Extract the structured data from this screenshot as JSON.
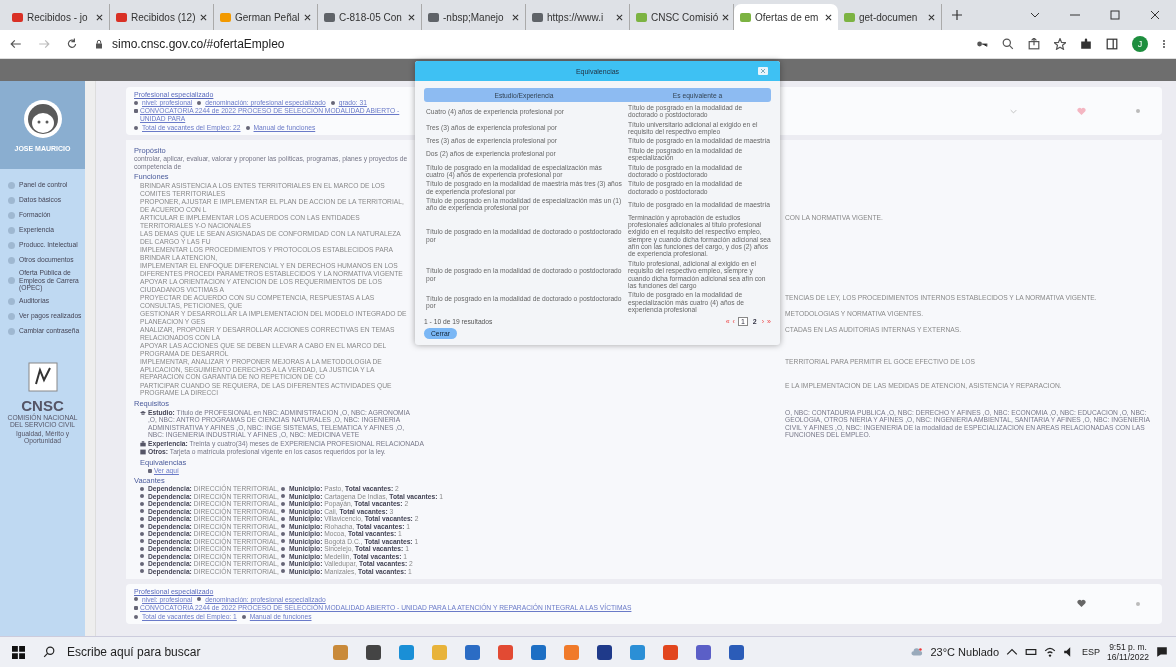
{
  "browser": {
    "tabs": [
      {
        "title": "Recibidos - jo",
        "selected": false
      },
      {
        "title": "Recibidos (12)",
        "selected": false
      },
      {
        "title": "German Peñal",
        "selected": false
      },
      {
        "title": "C-818-05 Con",
        "selected": false
      },
      {
        "title": "-nbsp;Manejo",
        "selected": false
      },
      {
        "title": "https://www.i",
        "selected": false
      },
      {
        "title": "CNSC Comisió",
        "selected": false
      },
      {
        "title": "Ofertas de em",
        "selected": true
      },
      {
        "title": "get-documen",
        "selected": false
      }
    ],
    "address": "simo.cnsc.gov.co/#ofertaEmpleo",
    "profile_initial": "J"
  },
  "sidebar": {
    "user_name": "JOSE MAURICIO",
    "items": [
      "Panel de control",
      "Datos básicos",
      "Formación",
      "Experiencia",
      "Producc. Intelectual",
      "Otros documentos",
      "Oferta Pública de Empleos de Carrera (OPEC)",
      "Auditorías",
      "Ver pagos realizados",
      "Cambiar contraseña"
    ],
    "logo": {
      "acronym": "CNSC",
      "name": "COMISIÓN NACIONAL DEL SERVICIO CIVIL",
      "slogan": "Igualdad, Mérito y Oportunidad"
    }
  },
  "job": {
    "title": "Profesional especializado",
    "meta": [
      "nivel: profesional",
      "denominación: profesional especializado",
      "grado: 31"
    ],
    "call": "CONVOCATORIA 2244 de 2022 PROCESO DE SELECCIÓN MODALIDAD ABIERTO - UNIDAD PARA",
    "links": [
      "Total de vacantes del Empleo: 22",
      "Manual de funciones"
    ],
    "purpose_heading": "Propósito",
    "purpose": "controlar, aplicar, evaluar, valorar y proponer las políticas, programas, planes y proyectos de competencia de",
    "functions_heading": "Funciones",
    "functions": [
      {
        "text": "BRINDAR ASISTENCIA A LOS ENTES TERRITORIALES EN EL MARCO DE LOS COMITES TERRITORIALES"
      },
      {
        "text": "PROPONER, AJUSTAR E IMPLEMENTAR EL PLAN DE ACCION DE LA TERRITORIAL, DE ACUERDO CON L"
      },
      {
        "text": "ARTICULAR E IMPLEMENTAR LOS ACUERDOS CON LAS ENTIDADES TERRITORIALES Y-O NACIONALES",
        "rest": "CON LA NORMATIVA VIGENTE."
      },
      {
        "text": "LAS DEMAS QUE LE SEAN ASIGNADAS DE CONFORMIDAD CON LA NATURALEZA DEL CARGO Y LAS FU"
      },
      {
        "text": "IMPLEMENTAR LOS PROCEDIMIENTOS Y PROTOCOLOS ESTABLECIDOS PARA BRINDAR LA ATENCION,"
      },
      {
        "text": "IMPLEMENTAR EL ENFOQUE DIFERENCIAL Y EN DERECHOS HUMANOS EN LOS DIFERENTES PROCEDI PARAMETROS ESTABLECIDOS Y LA NORMATIVA VIGENTE"
      },
      {
        "text": "APOYAR LA ORIENTACION Y ATENCION DE LOS REQUERIMIENTOS DE LOS CIUDADANOS VICTIMAS A"
      },
      {
        "text": "PROYECTAR DE ACUERDO CON SU COMPETENCIA, RESPUESTAS A LAS CONSULTAS, PETICIONES, QUE",
        "rest": "TENCIAS DE LEY, LOS PROCEDIMIENTOS INTERNOS ESTABLECIDOS Y LA NORMATIVA VIGENTE."
      },
      {
        "text": "GESTIONAR Y DESARROLLAR LA IMPLEMENTACION DEL MODELO INTEGRADO DE PLANEACION Y GES",
        "rest": "METODOLOGIAS Y NORMATIVA VIGENTES."
      },
      {
        "text": "ANALIZAR, PROPONER Y DESARROLLAR ACCIONES CORRECTIVAS EN TEMAS RELACIONADOS CON LA",
        "rest": "CTADAS EN LAS AUDITORIAS INTERNAS Y EXTERNAS."
      },
      {
        "text": "APOYAR LAS ACCIONES QUE SE DEBEN LLEVAR A CABO EN EL MARCO DEL PROGRAMA DE DESARROL"
      },
      {
        "text": "IMPLEMENTAR, ANALIZAR Y PROPONER MEJORAS A LA METODOLOGIA DE APLICACION, SEGUIMIENTO DERECHOS A LA VERDAD, LA JUSTICIA Y LA REPARACION CON GARANTIA DE NO REPETICION DE CO",
        "rest": "TERRITORIAL PARA PERMITIR EL GOCE EFECTIVO DE LOS"
      },
      {
        "text": "PARTICIPAR CUANDO SE REQUIERA, DE LAS DIFERENTES ACTIVIDADES QUE PROGRAME LA DIRECCI",
        "rest": "E LA IMPLEMENTACION DE LAS MEDIDAS DE ATENCION, ASISTENCIA Y REPARACION."
      }
    ],
    "requirements_heading": "Requisitos",
    "requirements": [
      {
        "kind": "study",
        "text": "**Estudio:** Título de PROFESIONAL en NBC: ADMINISTRACION ,O, NBC: AGRONOMIA ,O, NBC: ANTRO PROGRAMAS DE CIENCIAS NATURALES ,O, NBC: INGENIERIA ADMINISTRATIVA Y AFINES ,O, NBC: INGE SISTEMAS, TELEMATICA Y AFINES ,O, NBC: INGENIERIA INDUSTRIAL Y AFINES ,O, NBC: MEDICINA VETE",
        "rest": "O, NBC: CONTADURIA PUBLICA ,O, NBC: DERECHO Y AFINES ,O, NBC: ECONOMIA ,O, NBC: EDUCACION ,O, NBC: GEOLOGIA, OTROS NIERIA Y AFINES ,O, NBC: INGENIERIA AMBIENTAL, SANITARIA Y AFINES ,O, NBC: INGENIERIA CIVIL Y AFINES ,O, NBC: INGENIERIA DE la modalidad de ESPECIALIZACION EN AREAS RELACIONADAS CON LAS FUNCIONES DEL EMPLEO."
      },
      {
        "kind": "experience",
        "text": "**Experiencia:** Treinta y cuatro(34) meses de EXPERIENCIA PROFESIONAL RELACIONADA"
      },
      {
        "kind": "other",
        "text": "**Otros:** Tarjeta o matrícula profesional vigente en los casos requeridos por la ley."
      }
    ],
    "equivalences_heading": "Equivalencias",
    "equivalences_link": "Ver aquí",
    "vacancies_heading": "Vacantes",
    "vacancies": [
      {
        "dependency": "**Dependencia:** DIRECCIÓN TERRITORIAL,",
        "municipality": "**Municipio:** Pasto, **Total vacantes:** 2"
      },
      {
        "dependency": "**Dependencia:** DIRECCIÓN TERRITORIAL,",
        "municipality": "**Municipio:** Cartagena De Indias, **Total vacantes:** 1"
      },
      {
        "dependency": "**Dependencia:** DIRECCIÓN TERRITORIAL,",
        "municipality": "**Municipio:** Popayán, **Total vacantes:** 2"
      },
      {
        "dependency": "**Dependencia:** DIRECCIÓN TERRITORIAL,",
        "municipality": "**Municipio:** Cali, **Total vacantes:** 3"
      },
      {
        "dependency": "**Dependencia:** DIRECCIÓN TERRITORIAL,",
        "municipality": "**Municipio:** Villavicencio, **Total vacantes:** 2"
      },
      {
        "dependency": "**Dependencia:** DIRECCIÓN TERRITORIAL,",
        "municipality": "**Municipio:** Riohacha, **Total vacantes:** 1"
      },
      {
        "dependency": "**Dependencia:** DIRECCIÓN TERRITORIAL,",
        "municipality": "**Municipio:** Mocoa, **Total vacantes:** 1"
      },
      {
        "dependency": "**Dependencia:** DIRECCIÓN TERRITORIAL,",
        "municipality": "**Municipio:** Bogotá D.C., **Total vacantes:** 1"
      },
      {
        "dependency": "**Dependencia:** DIRECCIÓN TERRITORIAL,",
        "municipality": "**Municipio:** Sincelejo, **Total vacantes:** 1"
      },
      {
        "dependency": "**Dependencia:** DIRECCIÓN TERRITORIAL,",
        "municipality": "**Municipio:** Medellín, **Total vacantes:** 1"
      },
      {
        "dependency": "**Dependencia:** DIRECCIÓN TERRITORIAL,",
        "municipality": "**Municipio:** Valledupar, **Total vacantes:** 2"
      },
      {
        "dependency": "**Dependencia:** DIRECCIÓN TERRITORIAL,",
        "municipality": "**Municipio:** Manizales, **Total vacantes:** 1"
      }
    ]
  },
  "next_job": {
    "title": "Profesional especializado",
    "meta": [
      "nivel: profesional",
      "denominación: profesional especializado"
    ],
    "call": "CONVOCATORIA 2244 de 2022 PROCESO DE SELECCIÓN MODALIDAD ABIERTO - UNIDAD PARA LA ATENCIÓN Y REPARACIÓN INTEGRAL A LAS VÍCTIMAS",
    "links": [
      "Total de vacantes del Empleo: 1",
      "Manual de funciones"
    ]
  },
  "modal": {
    "title": "Equivalencias",
    "columns": [
      "Estudio/Experiencia",
      "Es equivalente a"
    ],
    "rows": [
      [
        "Cuatro (4) años de experiencia profesional por",
        "Título de posgrado en la modalidad de doctorado o postdoctorado"
      ],
      [
        "Tres (3) años de experiencia profesional por",
        "Título universitario adicional al exigido en el requisito del respectivo empleo"
      ],
      [
        "Tres (3) años de experiencia profesional por",
        "Título de posgrado en la modalidad de maestría"
      ],
      [
        "Dos (2) años de experiencia profesional por",
        "Título de posgrado en la modalidad de especialización"
      ],
      [
        "Título de posgrado en la modalidad de especialización más cuatro (4) años de experiencia profesional por",
        "Título de posgrado en la modalidad de doctorado o postdoctorado"
      ],
      [
        "Título de posgrado en la modalidad de maestría más tres (3) años de experiencia profesional por",
        "Título de posgrado en la modalidad de doctorado o postdoctorado"
      ],
      [
        "Título de posgrado en la modalidad de especialización más un (1) año de experiencia profesional por",
        "Título de posgrado en la modalidad de maestría"
      ],
      [
        "Título de posgrado en la modalidad de doctorado o postdoctorado por",
        "Terminación y aprobación de estudios profesionales adicionales al título profesional exigido en el requisito del respectivo empleo, siempre y cuando dicha formación adicional sea afín con las funciones del cargo, y dos (2) años de experiencia profesional."
      ],
      [
        "Título de posgrado en la modalidad de doctorado o postdoctorado por",
        "Título profesional, adicional al exigido en el requisito del respectivo empleo, siempre y cuando dicha formación adicional sea afín con las funciones del cargo"
      ],
      [
        "Título de posgrado en la modalidad de doctorado o postdoctorado por",
        "Título de posgrado en la modalidad de especialización más cuatro (4) años de experiencia profesional"
      ]
    ],
    "results": "1 - 10 de 19 resultados",
    "pager": {
      "first": "«",
      "prev": "‹",
      "pages": [
        {
          "label": "1",
          "selected": true
        },
        {
          "label": "2",
          "selected": false
        }
      ],
      "next": "›",
      "last": "»"
    },
    "close_button": "Cerrar"
  },
  "taskbar": {
    "search_placeholder": "Escribe aquí para buscar",
    "weather": "23°C Nublado",
    "language": "ESP",
    "time": "9:51 p. m.",
    "date": "16/11/2022"
  }
}
